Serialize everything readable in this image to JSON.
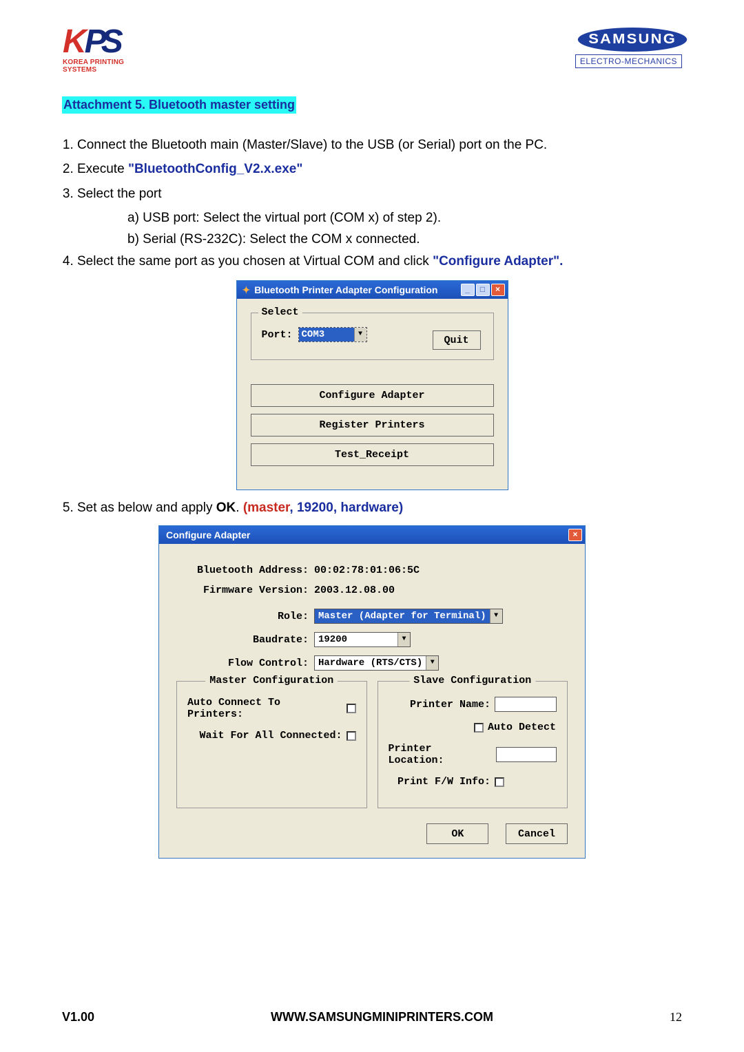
{
  "header": {
    "kps_sub": "KOREA PRINTING SYSTEMS",
    "samsung": "SAMSUNG",
    "samsung_sub": "ELECTRO-MECHANICS"
  },
  "heading": "Attachment 5. Bluetooth master setting",
  "steps": {
    "s1": "Connect the Bluetooth main (Master/Slave) to the USB (or Serial) port on the PC.",
    "s2a": "Execute ",
    "s2b": "\"BluetoothConfig_V2.x.exe\"",
    "s3": "Select the port",
    "s3a": "a) USB port: Select the virtual port (COM x) of step 2).",
    "s3b": "b) Serial (RS-232C): Select the COM x connected.",
    "s4a": "Select the same port as you chosen at Virtual COM and click ",
    "s4b": "\"Configure Adapter\".",
    "s5a": "Set as below and apply ",
    "s5b": "OK",
    "s5c": ". ",
    "s5d": "(master",
    "s5e": ", 19200, hardware)"
  },
  "dialog1": {
    "title": "Bluetooth Printer Adapter Configuration",
    "select_group": "Select",
    "port_label": "Port:",
    "port_value": "COM3",
    "quit": "Quit",
    "btn1": "Configure Adapter",
    "btn2": "Register Printers",
    "btn3": "Test_Receipt"
  },
  "dialog2": {
    "title": "Configure Adapter",
    "bt_addr_label": "Bluetooth Address:",
    "bt_addr": "00:02:78:01:06:5C",
    "fw_label": "Firmware Version:",
    "fw": "2003.12.08.00",
    "role_label": "Role:",
    "role": "Master (Adapter for Terminal)",
    "baud_label": "Baudrate:",
    "baud": "19200",
    "flow_label": "Flow Control:",
    "flow": "Hardware (RTS/CTS)",
    "master_group": "Master Configuration",
    "auto_connect": "Auto Connect To Printers:",
    "wait_all": "Wait For All Connected:",
    "slave_group": "Slave Configuration",
    "printer_name": "Printer Name:",
    "auto_detect": "Auto Detect",
    "printer_loc": "Printer Location:",
    "print_fw": "Print F/W Info:",
    "ok": "OK",
    "cancel": "Cancel"
  },
  "footer": {
    "version": "V1.00",
    "url": "WWW.SAMSUNGMINIPRINTERS.COM",
    "page": "12"
  }
}
